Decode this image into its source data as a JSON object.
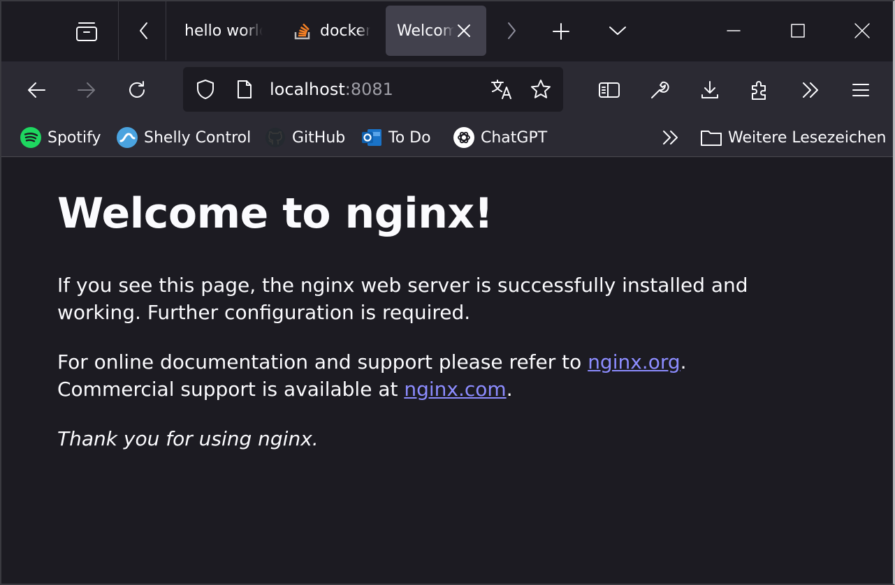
{
  "tabs": [
    {
      "label": "hello world",
      "active": false,
      "icon": "none"
    },
    {
      "label": "docker",
      "active": false,
      "icon": "stackoverflow-icon"
    },
    {
      "label": "Welcome to nginx!",
      "active": true,
      "icon": "none"
    }
  ],
  "toolbar": {
    "url_host": "localhost",
    "url_port": ":8081"
  },
  "bookmarks": [
    {
      "label": "Spotify",
      "icon": "spotify-icon"
    },
    {
      "label": "Shelly Control",
      "icon": "shelly-icon"
    },
    {
      "label": "GitHub",
      "icon": "github-icon"
    },
    {
      "label": "To Do",
      "icon": "outlook-icon"
    },
    {
      "label": "ChatGPT",
      "icon": "chatgpt-icon"
    }
  ],
  "other_bookmarks": "Weitere Lesezeichen",
  "page": {
    "heading": "Welcome to nginx!",
    "p1_line1": "If you see this page, the nginx web server is successfully installed and",
    "p1_line2": "working. Further configuration is required.",
    "p2_line1_pre": "For online documentation and support please refer to ",
    "p2_link1": "nginx.org",
    "p2_line1_post": ".",
    "p2_line2_pre": "Commercial support is available at ",
    "p2_link2": "nginx.com",
    "p2_line2_post": ".",
    "p3": "Thank you for using nginx."
  },
  "colors": {
    "background": "#1c1b22",
    "toolbar": "#2b2a33",
    "link": "#8c8cff",
    "spotify": "#1ed760"
  }
}
